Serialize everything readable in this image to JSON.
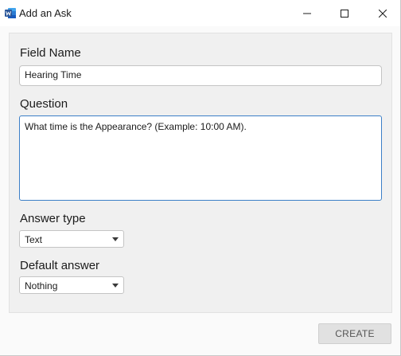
{
  "window": {
    "title": "Add an Ask",
    "app_icon": "word-icon",
    "controls": [
      "minimize-icon",
      "maximize-icon",
      "close-icon"
    ]
  },
  "form": {
    "field_name_label": "Field Name",
    "field_name_value": "Hearing Time",
    "question_label": "Question",
    "question_value": "What time is the Appearance? (Example: 10:00 AM).",
    "answer_type_label": "Answer type",
    "answer_type_value": "Text",
    "default_answer_label": "Default answer",
    "default_answer_value": "Nothing"
  },
  "actions": {
    "create_label": "CREATE"
  },
  "colors": {
    "accent_border": "#3c7fc7",
    "word_blue": "#2b579a"
  }
}
